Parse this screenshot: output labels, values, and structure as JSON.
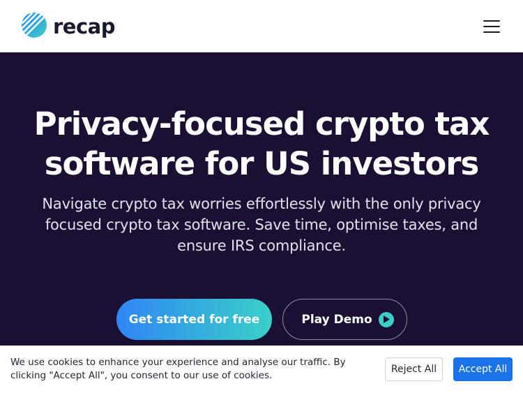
{
  "nav": {
    "brand_name": "recap",
    "logo_icon": "recap-logo-icon",
    "menu_icon": "hamburger-menu-icon"
  },
  "hero": {
    "title": "Privacy-focused crypto tax software for US investors",
    "subtitle": "Navigate crypto tax worries effortlessly with the only privacy focused crypto tax software. Save time, optimise taxes, and ensure IRS compliance.",
    "primary_button": "Get started for free",
    "secondary_button": "Play Demo",
    "play_icon": "play-circle-icon"
  },
  "cookie_banner": {
    "text": "We use cookies to enhance your experience and analyse our traffic. By clicking \"Accept All\", you consent to our use of cookies.",
    "reject_label": "Reject All",
    "accept_label": "Accept All"
  },
  "colors": {
    "hero_background": "#1b1033",
    "brand_blue": "#2f86f5",
    "brand_teal": "#3ad0c7",
    "accept_blue": "#1a73e8"
  }
}
